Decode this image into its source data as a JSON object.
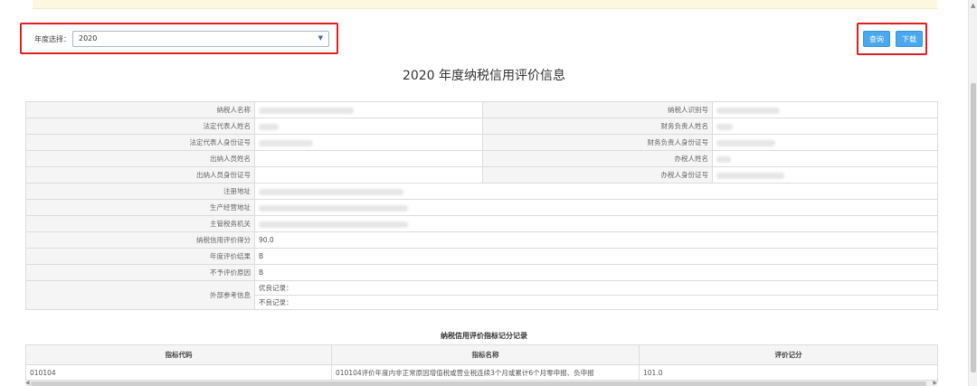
{
  "filter": {
    "year_label": "年度选择：",
    "year_value": "2020"
  },
  "buttons": {
    "query": "查询",
    "download": "下载"
  },
  "title": "2020 年度纳税信用评价信息",
  "info": {
    "taxpayer_name": "纳税人名称",
    "taxpayer_id": "纳税人识别号",
    "legal_rep_name": "法定代表人姓名",
    "finance_head_name": "财务负责人姓名",
    "legal_rep_id": "法定代表人身份证号",
    "finance_head_id": "财务负责人身份证号",
    "cashier_name": "出纳人员姓名",
    "tax_agent_name": "办税人姓名",
    "cashier_id": "出纳人员身份证号",
    "tax_agent_id": "办税人身份证号",
    "reg_address": "注册地址",
    "biz_address": "生产经营地址",
    "tax_authority": "主管税务机关",
    "credit_score_label": "纳税信用评价得分",
    "credit_score_value": "90.0",
    "annual_result_label": "年度评价结果",
    "annual_result_value": "B",
    "no_eval_reason_label": "不予评价原因",
    "no_eval_reason_value": "B",
    "external_ref_label": "外部参考信息",
    "good_record": "优良记录：",
    "bad_record": "不良记录："
  },
  "score_table": {
    "title": "纳税信用评价指标记分记录",
    "headers": [
      "指标代码",
      "指标名称",
      "评价记分"
    ],
    "rows": [
      {
        "code": "010104",
        "name": "010104评价年度内非正常原因增值税或营业税连续3个月或累计6个月零申报、负申报",
        "score": "101.0"
      }
    ]
  },
  "icons": [
    "chevron-down-icon",
    "scroll-up-arrow-icon",
    "scroll-left-arrow-icon",
    "scroll-right-arrow-icon"
  ],
  "colors": {
    "button_blue": "#4aa8ef",
    "highlight_red": "#e02020",
    "label_bg": "#f5f5f5",
    "border": "#dcdcdc"
  }
}
